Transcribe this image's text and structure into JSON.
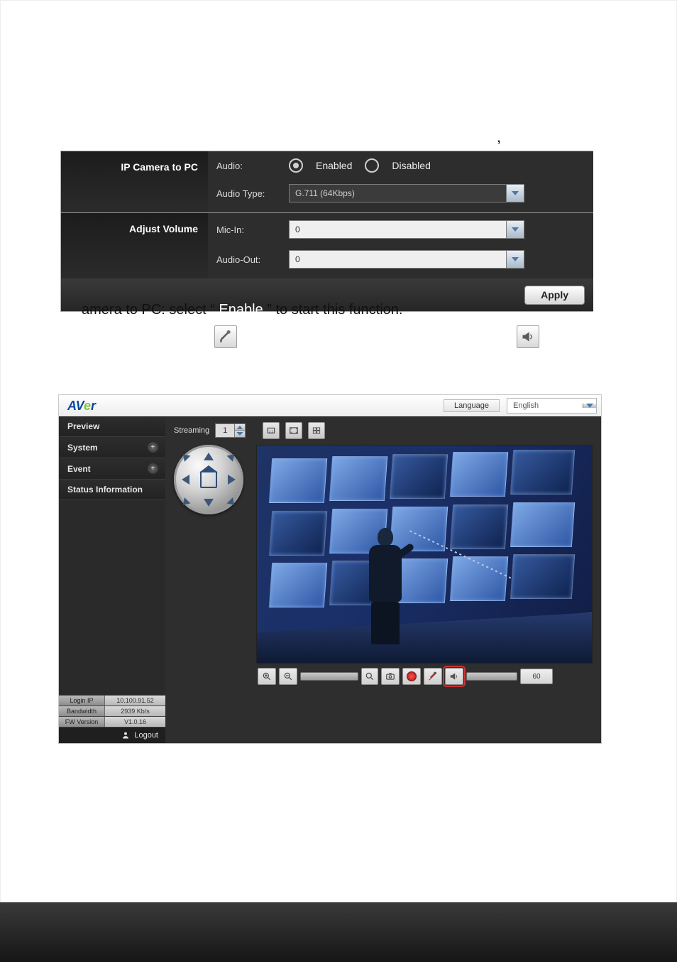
{
  "panel": {
    "section1_title": "IP Camera to PC",
    "audio_label": "Audio:",
    "audio_enabled": "Enabled",
    "audio_disabled": "Disabled",
    "audio_type_label": "Audio Type:",
    "audio_type_value": "G.711 (64Kbps)",
    "section2_title": "Adjust Volume",
    "mic_in_label": "Mic-In:",
    "mic_in_value": "0",
    "audio_out_label": "Audio-Out:",
    "audio_out_value": "0",
    "apply_label": "Apply"
  },
  "sentence": {
    "part1": "amera to PC: select “",
    "part2": "” to start this function."
  },
  "hidden_marker": ",",
  "app": {
    "logo_text": "AVer",
    "language_label": "Language",
    "language_value": "English",
    "sidebar": {
      "items": [
        {
          "label": "Preview",
          "expandable": false
        },
        {
          "label": "System",
          "expandable": true
        },
        {
          "label": "Event",
          "expandable": true
        },
        {
          "label": "Status Information",
          "expandable": false
        }
      ],
      "status": [
        {
          "key": "Login IP",
          "value": "10.100.91.52"
        },
        {
          "key": "Bandwidth",
          "value": "2939 Kb/s"
        },
        {
          "key": "FW Version",
          "value": "V1.0.16"
        }
      ],
      "logout_label": "Logout"
    },
    "main": {
      "streaming_label": "Streaming",
      "streaming_value": "1",
      "bottom_number": "60"
    }
  }
}
